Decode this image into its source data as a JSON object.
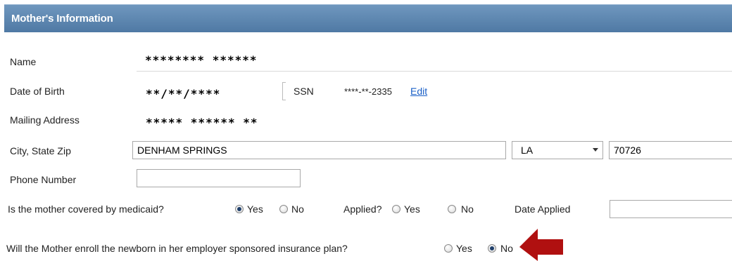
{
  "header": {
    "title": "Mother's Information"
  },
  "fields": {
    "name": {
      "label": "Name",
      "value": "******** ******"
    },
    "dob": {
      "label": "Date of Birth",
      "value": "**/**/****"
    },
    "ssn": {
      "label": "SSN",
      "value": "****-**-2335",
      "edit_label": "Edit"
    },
    "mailing": {
      "label": "Mailing Address",
      "value": "***** ****** **"
    },
    "city_state_zip": {
      "label": "City, State Zip",
      "city": "DENHAM SPRINGS",
      "state": "LA",
      "zip": "70726"
    },
    "phone": {
      "label": "Phone Number",
      "value": ""
    }
  },
  "medicaid": {
    "question": "Is the mother covered by medicaid?",
    "yes_label": "Yes",
    "no_label": "No",
    "selected": "Yes",
    "applied_label": "Applied?",
    "applied_yes_label": "Yes",
    "applied_no_label": "No",
    "applied_selected": "",
    "date_applied_label": "Date Applied",
    "date_applied_value": ""
  },
  "employer_plan": {
    "question": "Will the Mother enroll the newborn in her employer sponsored insurance plan?",
    "yes_label": "Yes",
    "no_label": "No",
    "selected": "No"
  },
  "annotation": {
    "arrow_color": "#b01010"
  }
}
